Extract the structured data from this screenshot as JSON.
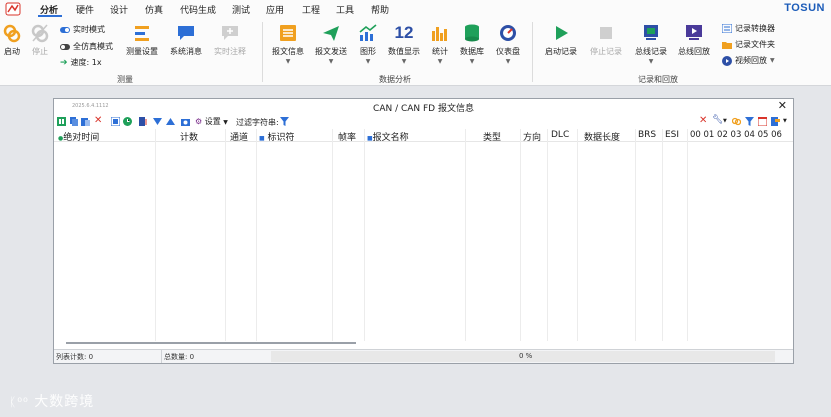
{
  "menubar": {
    "items": [
      "分析",
      "硬件",
      "设计",
      "仿真",
      "代码生成",
      "测试",
      "应用",
      "工程",
      "工具",
      "帮助"
    ],
    "brand": "TOSUN"
  },
  "ribbon": {
    "start": "启动",
    "stop": "停止",
    "realtime_mode": "实时模式",
    "full_sim_mode": "全仿真模式",
    "speed": "速度: 1x",
    "measure_settings": "测量设置",
    "system_messages": "系统消息",
    "realtime_notes": "实时注释",
    "group_measure": "测量",
    "msg_info": "报文信息",
    "msg_send": "报文发送",
    "graphics": "图形",
    "numeric_display": "数值显示",
    "numeric_value": "12",
    "statistics": "统计",
    "database": "数据库",
    "dashboard": "仪表盘",
    "group_analysis": "数据分析",
    "start_record": "启动记录",
    "stop_record": "停止记录",
    "bus_record": "总线记录",
    "bus_replay": "总线回放",
    "record_converter": "记录转换器",
    "record_folder": "记录文件夹",
    "video_replay": "视频回放",
    "group_record": "记录和回放"
  },
  "window": {
    "title": "CAN / CAN FD 报文信息",
    "date": "2025.6.4.1112",
    "settings": "设置",
    "filter_label": "过滤字符串:",
    "columns": [
      "绝对时间",
      "计数",
      "通道",
      "标识符",
      "帧率",
      "报文名称",
      "类型",
      "方向",
      "DLC",
      "数据长度",
      "BRS",
      "ESI",
      "00 01 02 03 04 05 06"
    ],
    "status": {
      "list_count": "列表计数: 0",
      "total_count": "总数量: 0",
      "progress_text": "0 %",
      "progress": 0
    }
  },
  "watermark": "大数跨境",
  "colors": {
    "accent": "#2d6fd6",
    "start_green": "#1fa05a",
    "brand_blue": "#1b5bb8",
    "close_red": "#d9342b"
  }
}
